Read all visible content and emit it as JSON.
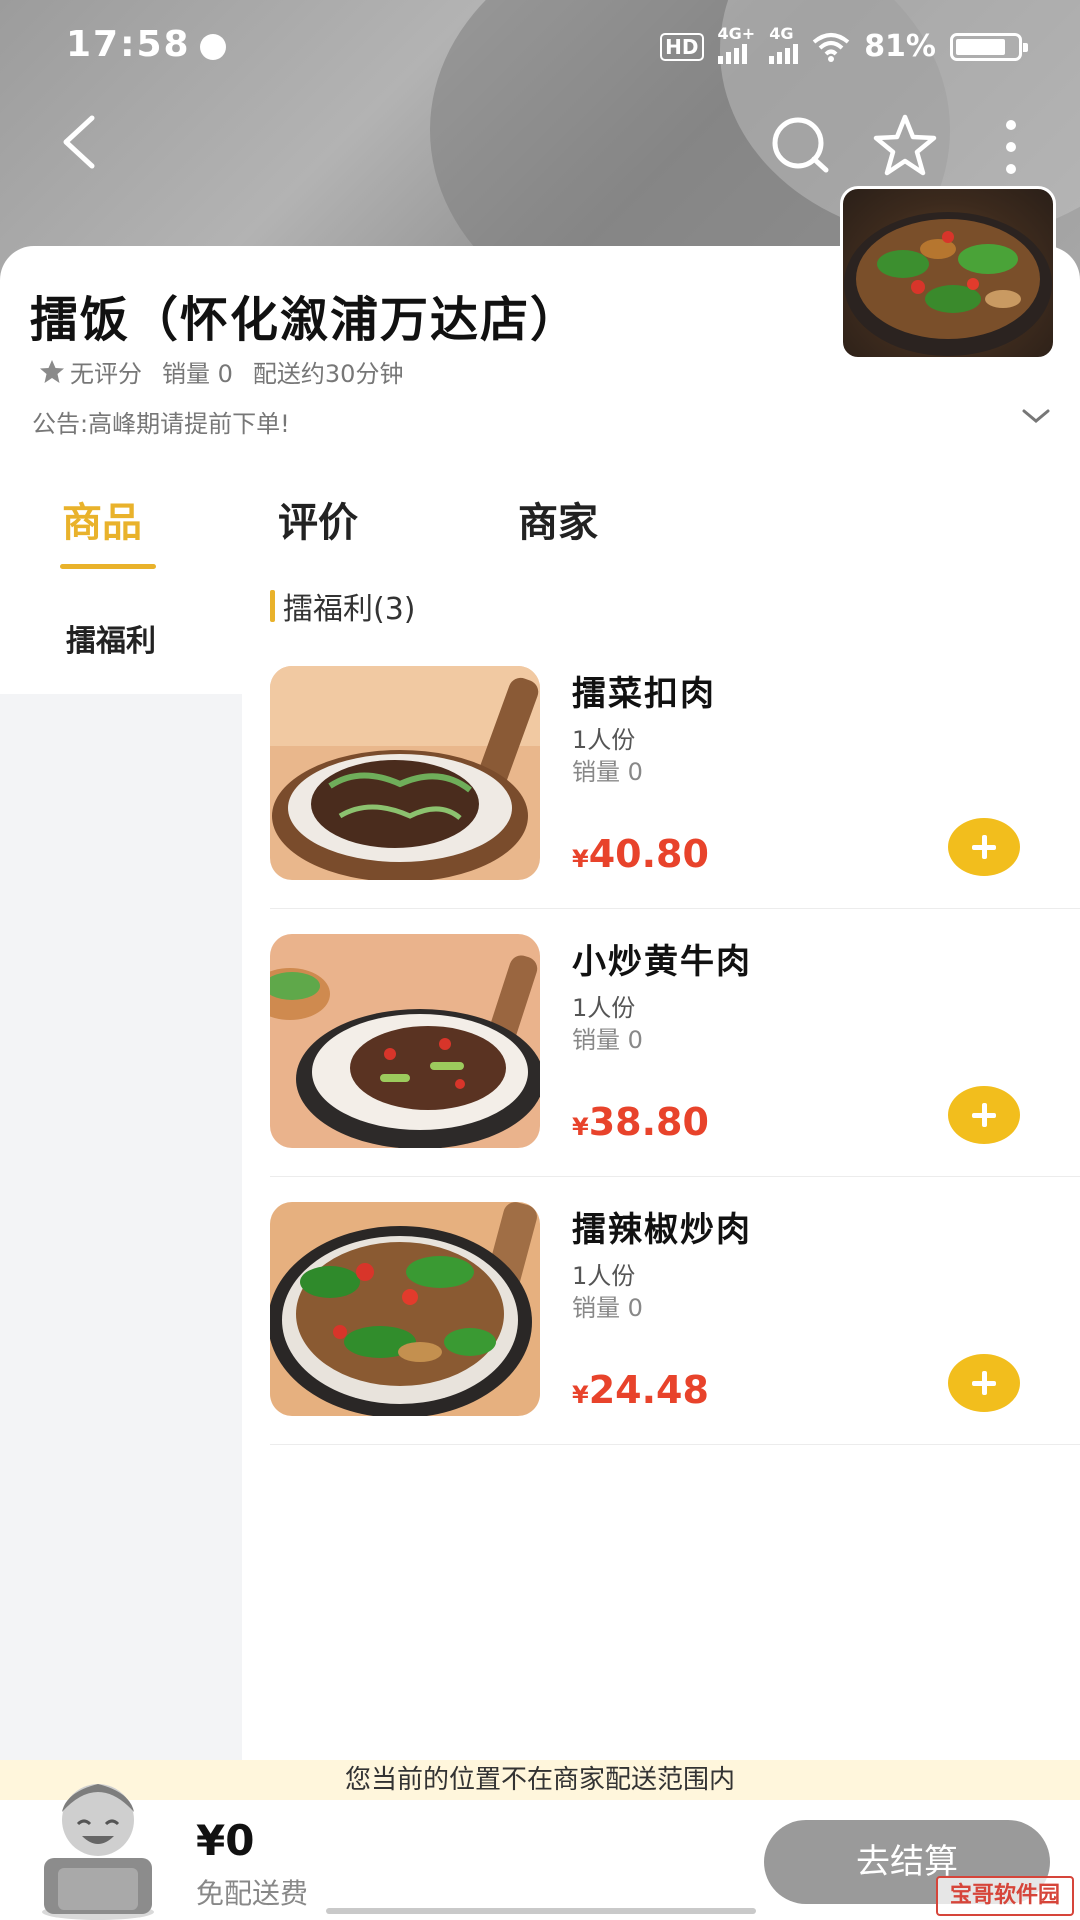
{
  "status_bar": {
    "time": "17:58",
    "hd": "HD",
    "net1": "4G+",
    "net2": "4G",
    "battery": "81%",
    "battery_level": 0.81
  },
  "store": {
    "name": "擂饭（怀化溆浦万达店）",
    "rating": "无评分",
    "sales": "销量 0",
    "delivery_time": "配送约30分钟",
    "notice": "公告:高峰期请提前下单!"
  },
  "tabs": [
    {
      "label": "商品",
      "active": true
    },
    {
      "label": "评价",
      "active": false
    },
    {
      "label": "商家",
      "active": false
    }
  ],
  "sidebar": {
    "items": [
      {
        "label": "擂福利"
      }
    ]
  },
  "section": {
    "title": "擂福利(3)"
  },
  "products": [
    {
      "name": "擂菜扣肉",
      "portion": "1人份",
      "sales": "销量 0",
      "currency": "¥",
      "price": "40.80"
    },
    {
      "name": "小炒黄牛肉",
      "portion": "1人份",
      "sales": "销量 0",
      "currency": "¥",
      "price": "38.80"
    },
    {
      "name": "擂辣椒炒肉",
      "portion": "1人份",
      "sales": "销量 0",
      "currency": "¥",
      "price": "24.48"
    }
  ],
  "bottom": {
    "warning": "您当前的位置不在商家配送范围内",
    "total": "¥0",
    "fee": "免配送费",
    "checkout": "去结算"
  },
  "watermark": "宝哥软件园",
  "colors": {
    "accent": "#e9b22b",
    "price": "#e8432b",
    "add_button": "#f2be1d",
    "checkout_disabled": "#9a9a9a"
  },
  "icons": [
    "back-arrow-icon",
    "search-icon",
    "star-icon",
    "more-vertical-icon",
    "chevron-down-icon",
    "plus-icon",
    "cart-avatar-icon"
  ]
}
